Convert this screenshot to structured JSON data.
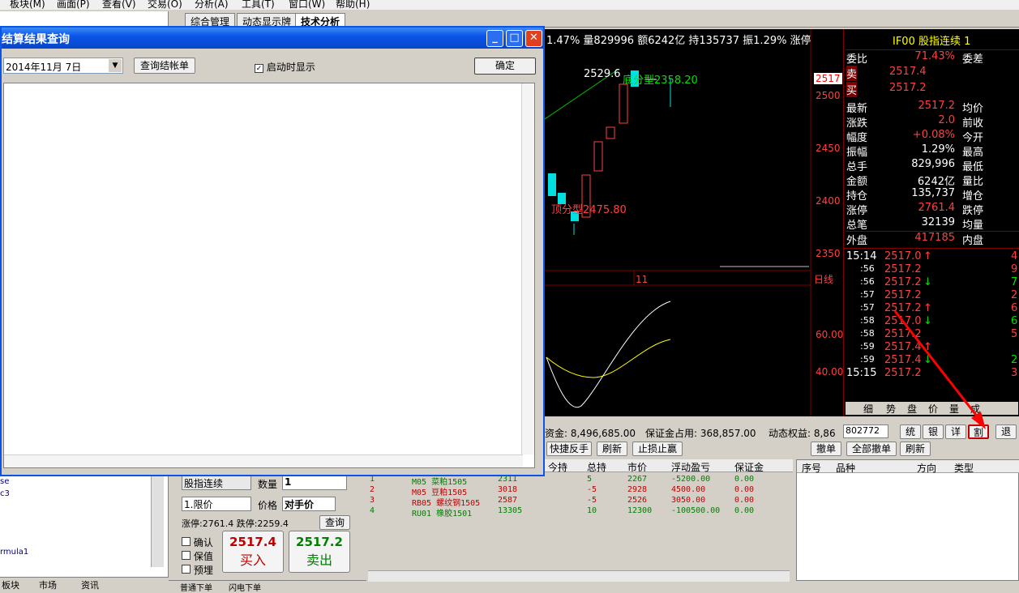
{
  "menubar": [
    "板块(M)",
    "画面(P)",
    "查看(V)",
    "交易(O)",
    "分析(A)",
    "工具(T)",
    "窗口(W)",
    "帮助(H)"
  ],
  "tabs": [
    "综合管理",
    "动态显示牌",
    "技术分析"
  ],
  "dialog": {
    "title": "结算结果查询",
    "date_value": "2014年11月 7日",
    "query_button": "查询结帐单",
    "startup_checkbox": "启动时显示",
    "ok_button": "确定",
    "controls": {
      "minimize": "_",
      "maximize": "□",
      "close": "✕"
    }
  },
  "chart_header": "1.47% 量829996 额6242亿 持135737 振1.29% 涨停",
  "chart": {
    "annotations": [
      "2529.6",
      "底分型2358.20",
      "顶分型2475.80"
    ],
    "price_ticks": [
      "2517",
      "2500",
      "2450",
      "2400",
      "2350"
    ],
    "period": "日线",
    "date_tick": "11",
    "indicator_ticks": [
      "60.00",
      "40.00"
    ]
  },
  "quote": {
    "header": "IF00  股指连续  1",
    "weibi": {
      "label": "委比",
      "value": "71.43%",
      "right": "委差"
    },
    "sell": {
      "label": "卖",
      "price": "2517.4"
    },
    "buy": {
      "label": "买",
      "price": "2517.2"
    },
    "rows": [
      {
        "label": "最新",
        "value": "2517.2",
        "right": "均价",
        "color": "red"
      },
      {
        "label": "涨跌",
        "value": "2.0",
        "right": "前收",
        "color": "red"
      },
      {
        "label": "幅度",
        "value": "+0.08%",
        "right": "今开",
        "color": "red"
      },
      {
        "label": "振幅",
        "value": "1.29%",
        "right": "最高",
        "color": "white"
      },
      {
        "label": "总手",
        "value": "829,996",
        "right": "最低",
        "color": "white"
      },
      {
        "label": "金额",
        "value": "6242亿",
        "right": "量比",
        "color": "white"
      },
      {
        "label": "持仓",
        "value": "135,737",
        "right": "增仓",
        "color": "white"
      },
      {
        "label": "涨停",
        "value": "2761.4",
        "right": "跌停",
        "color": "red"
      },
      {
        "label": "总笔",
        "value": "32139",
        "right": "均量",
        "color": "white"
      }
    ],
    "outer": {
      "label": "外盘",
      "value": "417185",
      "right": "内盘"
    },
    "ticks": [
      {
        "time": "15:14",
        "price": "2517.0",
        "arrow": "↑",
        "vol": "4"
      },
      {
        "time": ":56",
        "price": "2517.2",
        "arrow": "",
        "vol": "9"
      },
      {
        "time": ":56",
        "price": "2517.2",
        "arrow": "↓",
        "vol": "7"
      },
      {
        "time": ":57",
        "price": "2517.2",
        "arrow": "",
        "vol": "2"
      },
      {
        "time": ":57",
        "price": "2517.2",
        "arrow": "↑",
        "vol": "6"
      },
      {
        "time": ":58",
        "price": "2517.0",
        "arrow": "↓",
        "vol": "6"
      },
      {
        "time": ":58",
        "price": "2517.2",
        "arrow": "",
        "vol": "5"
      },
      {
        "time": ":59",
        "price": "2517.4",
        "arrow": "↑",
        "vol": ""
      },
      {
        "time": ":59",
        "price": "2517.4",
        "arrow": "↓",
        "vol": "2"
      },
      {
        "time": "15:15",
        "price": "2517.2",
        "arrow": "",
        "vol": "3"
      }
    ],
    "bottom_tabs": [
      "细",
      "势",
      "盘",
      "价",
      "量",
      "成"
    ]
  },
  "account": {
    "funds": "资金: 8,496,685.00",
    "margin": "保证金占用: 368,857.00",
    "equity": "动态权益: 8,86",
    "account_id": "802772",
    "buttons": [
      "统",
      "银",
      "详",
      "割",
      "退"
    ]
  },
  "positions": {
    "actions": [
      "快捷反手",
      "刷新",
      "止损止赢"
    ],
    "headers": [
      "今持",
      "总持",
      "市价",
      "浮动盈亏",
      "保证金"
    ],
    "rows": [
      {
        "no": "1",
        "code": "M05 菜粕1505",
        "price": "2311",
        "total": "5",
        "market": "2267",
        "pnl": "-5200.00",
        "margin": "0.00",
        "color": "green"
      },
      {
        "no": "2",
        "code": "M05 豆粕1505",
        "price": "3018",
        "total": "-5",
        "market": "2928",
        "pnl": "4500.00",
        "margin": "0.00",
        "color": "red"
      },
      {
        "no": "3",
        "code": "RB05 螺纹钢1505",
        "price": "2587",
        "total": "-5",
        "market": "2526",
        "pnl": "3050.00",
        "margin": "0.00",
        "color": "red"
      },
      {
        "no": "4",
        "code": "RU01 橡胶1501",
        "price": "13305",
        "total": "10",
        "market": "12300",
        "pnl": "-100500.00",
        "margin": "0.00",
        "color": "green"
      }
    ]
  },
  "orders": {
    "actions": [
      "撤单",
      "全部撤单",
      "刷新"
    ],
    "headers": [
      "序号",
      "品种",
      "方向",
      "类型"
    ]
  },
  "order_panel": {
    "instrument": "股指连续",
    "qty_label": "数量",
    "qty_value": "1",
    "type_value": "1.限价",
    "price_label": "价格",
    "price_value": "对手价",
    "limits": "涨停:2761.4 跌停:2259.4",
    "query_button": "查询",
    "checks": [
      "确认",
      "保值",
      "预埋"
    ],
    "buy_price": "2517.4",
    "buy_label": "买入",
    "sell_price": "2517.2",
    "sell_label": "卖出"
  },
  "left_tree": [
    "se",
    "c3",
    "rmula1"
  ],
  "bottom_tabs": [
    "板块",
    "市场",
    "资讯",
    "普通下单",
    "闪电下单"
  ],
  "colors": {
    "accent": "#0a54e8",
    "up": "#ff4040",
    "down": "#00e000",
    "bg_chart": "#000000"
  }
}
